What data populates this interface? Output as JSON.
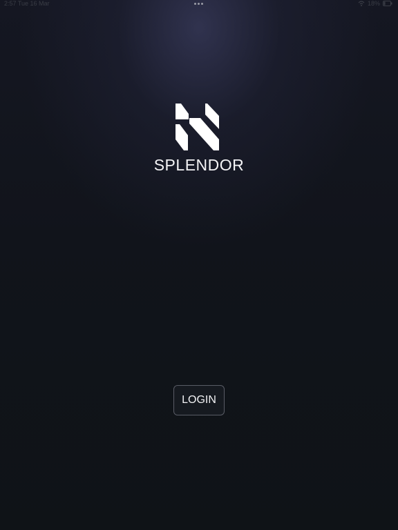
{
  "status_bar": {
    "left_text": "2:57  Tue 16 Mar",
    "battery": "18%",
    "wifi_icon": "wifi-icon",
    "battery_icon": "battery-icon"
  },
  "multitask_icon": "multitask-dots-icon",
  "logo": {
    "icon": "splendor-logo-icon",
    "brand_name": "SPLENDOR"
  },
  "login": {
    "label": "LOGIN"
  },
  "colors": {
    "background": "#11141b",
    "glow": "#3a3c5e",
    "text": "#ffffff",
    "button_border": "#5a5d66"
  }
}
